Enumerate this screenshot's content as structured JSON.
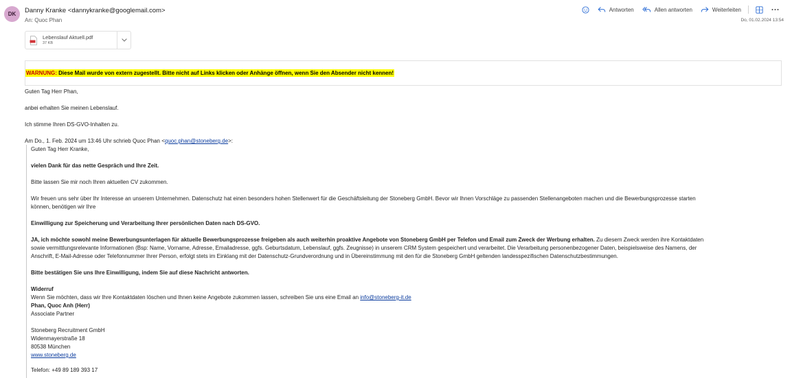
{
  "header": {
    "avatar_initials": "DK",
    "sender": "Danny Kranke <dannykranke@googlemail.com>",
    "to": "An:  Quoc Phan",
    "date": "Do, 01.02.2024 13:54",
    "actions": {
      "reply": "Antworten",
      "reply_all": "Allen antworten",
      "forward": "Weiterleiten"
    }
  },
  "attachment": {
    "name": "Lebenslauf Aktuell.pdf",
    "size": "37 KB"
  },
  "warning": {
    "prefix": "WARNUNG:",
    "text": " Diese Mail wurde von extern zugestellt. Bitte nicht auf Links klicken oder Anhänge öffnen, wenn Sie den Absender nicht kennen!"
  },
  "body": {
    "greeting": "Guten Tag Herr Phan,",
    "line1": "anbei erhalten Sie meinen Lebenslauf.",
    "line2": "Ich stimme Ihren DS-GVO-Inhalten zu.",
    "quote_header_pre": "Am Do., 1. Feb. 2024 um 13:46 Uhr schrieb Quoc Phan <",
    "quote_header_email": "quoc.phan@stoneberg.de",
    "quote_header_post": ">:"
  },
  "quoted": {
    "greeting": "Guten Tag Herr Kranke,",
    "thanks": "vielen Dank für das nette Gespräch und Ihre Zeit.",
    "cv_request": "Bitte lassen Sie mir noch Ihren aktuellen CV zukommen.",
    "privacy_line1": "Wir freuen uns sehr über Ihr Interesse an unserem Unternehmen. Datenschutz hat einen besonders hohen Stellenwert für die Geschäftsleitung der Stoneberg GmbH. Bevor wir Ihnen Vorschläge zu passenden Stellenangeboten machen und die Bewerbungsprozesse starten",
    "privacy_line2": "können, benötigen wir Ihre",
    "consent_heading": "Einwilligung zur Speicherung und Verarbeitung Ihrer persönlichen Daten nach DS-GVO.",
    "consent_bold": "JA, ich möchte sowohl meine Bewerbungsunterlagen für aktuelle Bewerbungsprozesse freigeben als auch weiterhin proaktive Angebote von Stoneberg GmbH per Telefon und Email zum Zweck der Werbung erhalten.",
    "consent_rest1": " Zu diesem Zweck werden ihre Kontaktdaten",
    "consent_line2": "sowie vermittlungsrelevante Informationen (Bsp: Name, Vorname, Adresse, Emailadresse, ggfs. Geburtsdatum, Lebenslauf, ggfs. Zeugnisse) in unserem CRM System gespeichert und verarbeitet. Die Verarbeitung personenbezogener Daten, beispielsweise des Namens, der",
    "consent_line3": "Anschrift, E-Mail-Adresse oder Telefonnummer Ihrer Person, erfolgt stets im Einklang mit der Datenschutz-Grundverordnung und in Übereinstimmung mit den für die Stoneberg GmbH geltenden landesspezifischen Datenschutzbestimmungen.",
    "confirm": "Bitte bestätigen Sie uns Ihre Einwilligung, indem Sie auf diese Nachricht antworten.",
    "widerruf_heading": "Widerruf",
    "widerruf_text": "Wenn Sie möchten, dass wir Ihre Kontaktdaten löschen und Ihnen keine Angebote zukommen lassen, schreiben Sie uns eine Email an ",
    "widerruf_email": "info@stoneberg-it.de",
    "sig_name": "Phan, Quoc Anh (Herr)",
    "sig_title": "Associate Partner",
    "company": "Stoneberg Recruitment GmbH",
    "street": "Widenmayerstraße 18",
    "city": "80538 München",
    "website": "www.stoneberg.de",
    "phone_partial": "Telefon: +49 89 189 393 17"
  }
}
